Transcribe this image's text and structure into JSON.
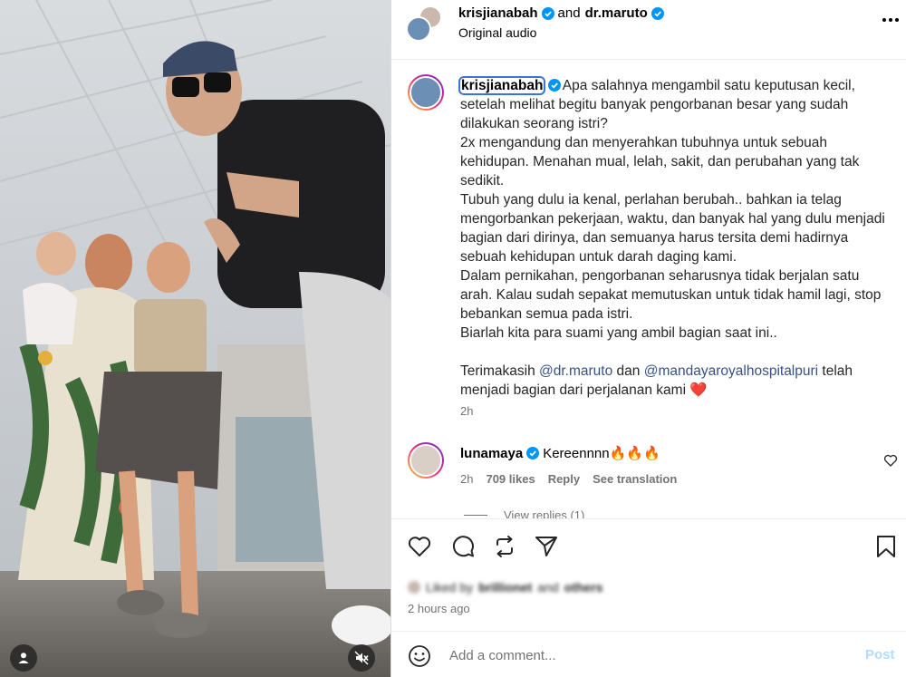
{
  "header": {
    "author": "krisjianabah",
    "conjunction": "and",
    "coauthor": "dr.maruto",
    "audio": "Original audio",
    "more_icon": "more-horizontal-icon"
  },
  "caption": {
    "username": "krisjianabah",
    "lines": [
      "Apa salahnya mengambil satu keputusan kecil, setelah melihat begitu banyak pengorbanan besar yang sudah dilakukan seorang istri?",
      "2x mengandung dan menyerahkan tubuhnya untuk sebuah kehidupan. Menahan mual, lelah, sakit, dan perubahan yang tak sedikit.",
      "Tubuh yang dulu ia kenal, perlahan berubah.. bahkan ia telag mengorbankan pekerjaan, waktu, dan banyak hal yang dulu menjadi bagian dari dirinya, dan semuanya harus tersita demi hadirnya sebuah kehidupan untuk darah daging kami.",
      "Dalam pernikahan, pengorbanan seharusnya tidak berjalan satu arah. Kalau sudah sepakat memutuskan untuk tidak hamil lagi, stop bebankan semua pada istri.",
      "Biarlah kita para suami yang ambil bagian saat ini.."
    ],
    "thanks_prefix": "Terimakasih",
    "mention1": "@dr.maruto",
    "thanks_mid": "dan",
    "mention2": "@mandayaroyalhospitalpuri",
    "thanks_suffix": "telah menjadi bagian dari perjalanan kami ❤️",
    "time": "2h"
  },
  "comment": {
    "username": "lunamaya",
    "text": "Kereennnn🔥🔥🔥",
    "time": "2h",
    "likes": "709 likes",
    "reply": "Reply",
    "translate": "See translation",
    "view_replies": "View replies (1)"
  },
  "actions": {
    "like_icon": "heart-icon",
    "comment_icon": "comment-icon",
    "repost_icon": "repost-icon",
    "share_icon": "share-icon",
    "save_icon": "bookmark-icon",
    "liked_by_prefix": "Liked by",
    "liked_by_user": "brillionet",
    "liked_by_and": "and",
    "liked_by_others": "others",
    "post_time": "2 hours ago"
  },
  "add_comment": {
    "placeholder": "Add a comment...",
    "post_label": "Post"
  },
  "colors": {
    "verified": "#0095f6",
    "link": "#385185",
    "post_disabled": "#b3dbff",
    "secondary_text": "#737373"
  }
}
